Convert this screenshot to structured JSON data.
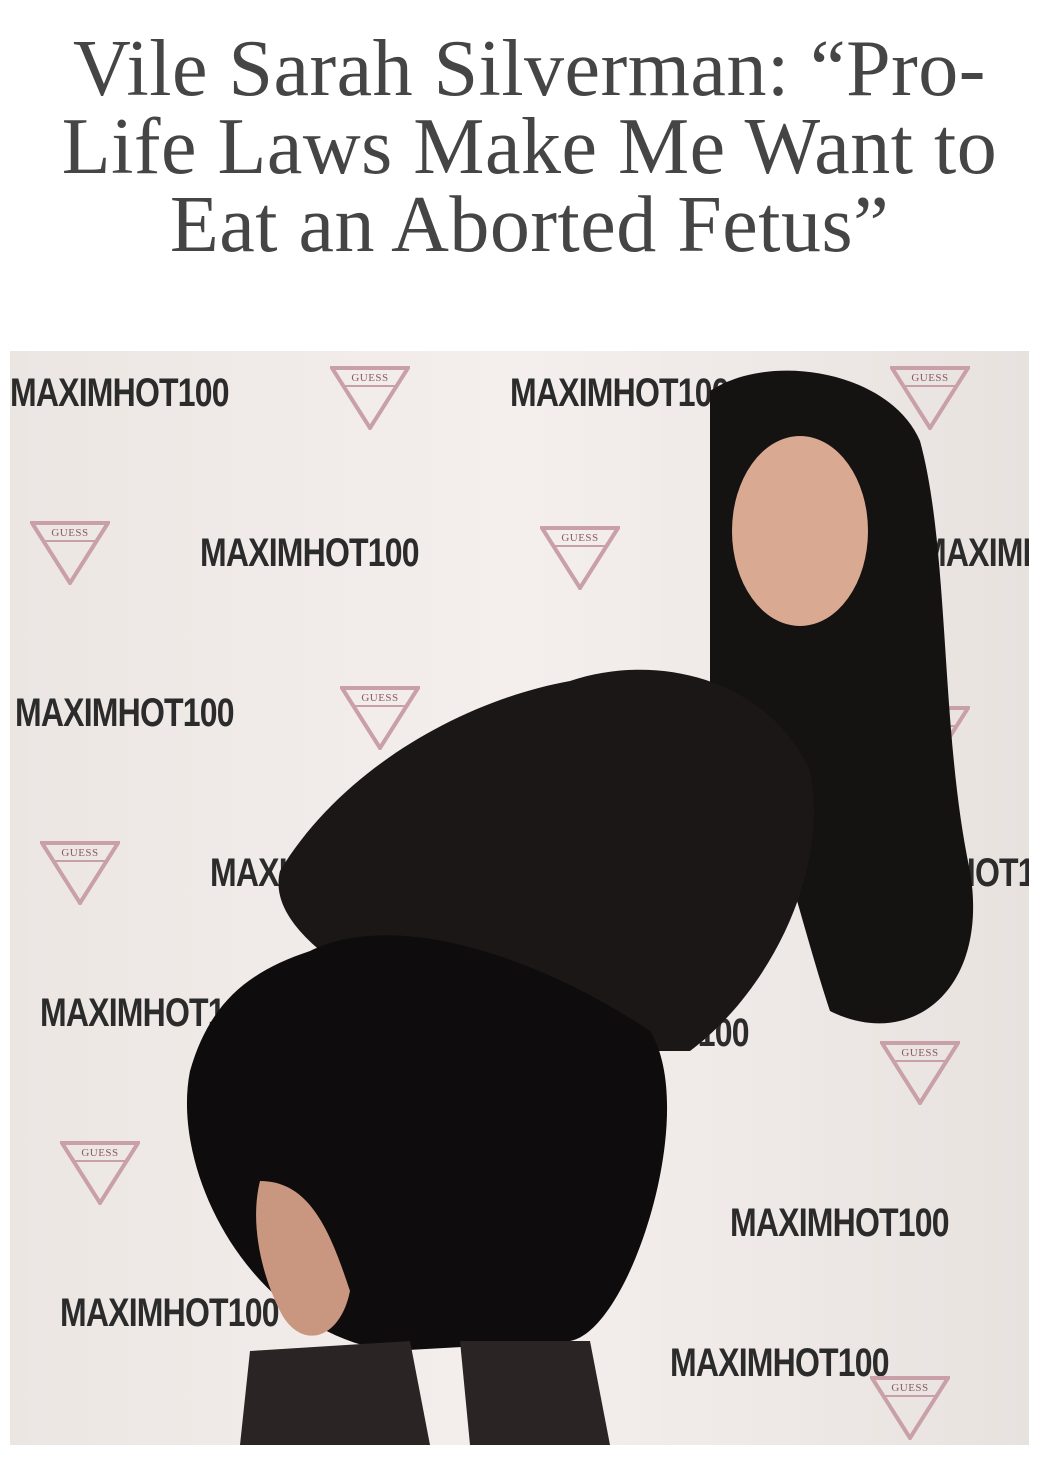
{
  "article": {
    "headline": "Vile Sarah Silverman: “Pro-Life Laws Make Me Want to Eat an Aborted Fetus”",
    "image": {
      "alt": "Sarah Silverman posing in front of a Maxim Hot 100 backdrop",
      "backdrop_logo": "MAXIMHOT100",
      "backdrop_brand": "GUESS"
    }
  }
}
